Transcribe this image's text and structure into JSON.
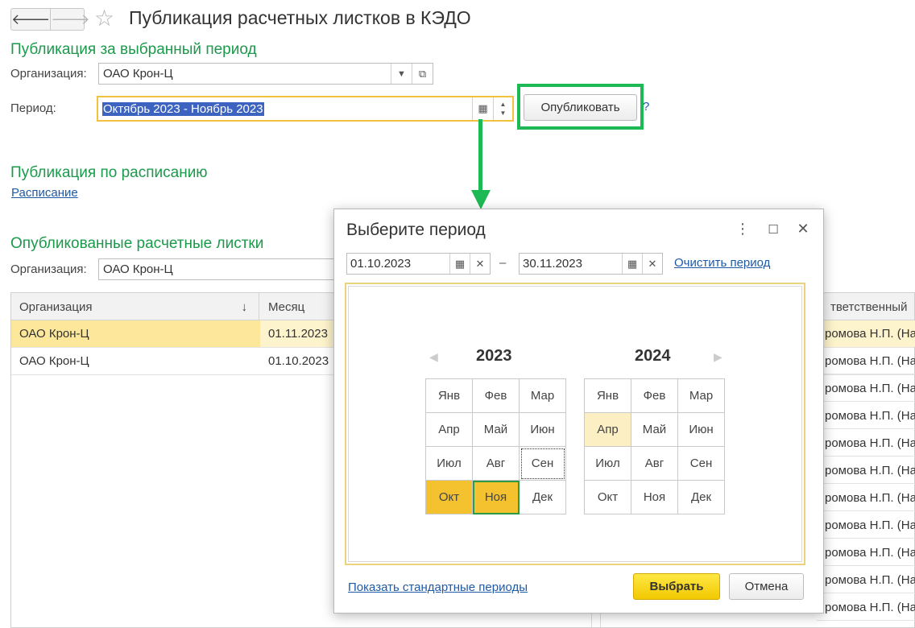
{
  "window": {
    "title": "Публикация расчетных листков в КЭДО"
  },
  "nav": {
    "back": "🡐",
    "forward": "🡒",
    "favorite": "☆"
  },
  "publish_section": {
    "title": "Публикация за выбранный период",
    "org_label": "Организация:",
    "org_value": "ОАО Крон-Ц",
    "period_label": "Период:",
    "period_value": "Октябрь 2023 - Ноябрь 2023",
    "publish_button": "Опубликовать",
    "help": "?"
  },
  "schedule_section": {
    "title": "Публикация по расписанию",
    "link": "Расписание"
  },
  "published_section": {
    "title": "Опубликованные расчетные листки",
    "org_label": "Организация:",
    "org_value": "ОАО Крон-Ц"
  },
  "table": {
    "columns": {
      "org": "Организация",
      "month": "Месяц",
      "responsible": "тветственный"
    },
    "sort_icon": "↓",
    "rows": [
      {
        "org": "ОАО Крон-Ц",
        "month": "01.11.2023"
      },
      {
        "org": "ОАО Крон-Ц",
        "month": "01.10.2023"
      }
    ],
    "responsible_values": [
      "ромова Н.П. (На",
      "ромова Н.П. (На",
      "ромова Н.П. (На",
      "ромова Н.П. (На",
      "ромова Н.П. (На",
      "ромова Н.П. (На",
      "ромова Н.П. (На",
      "ромова Н.П. (На",
      "ромова Н.П. (На",
      "ромова Н.П. (На",
      "ромова Н.П. (На",
      "ромова Н.П. (На"
    ]
  },
  "dialog": {
    "title": "Выберите период",
    "more_icon": "⋮",
    "maximize_icon": "☐",
    "close_icon": "✕",
    "date_from": "01.10.2023",
    "date_to": "30.11.2023",
    "dash": "–",
    "clear_link": "Очистить период",
    "prev_arrow": "◀",
    "next_arrow": "▶",
    "year_left": "2023",
    "year_right": "2024",
    "months": [
      "Янв",
      "Фев",
      "Мар",
      "Апр",
      "Май",
      "Июн",
      "Июл",
      "Авг",
      "Сен",
      "Окт",
      "Ноя",
      "Дек"
    ],
    "standard_periods_link": "Показать стандартные периоды",
    "ok_button": "Выбрать",
    "cancel_button": "Отмена"
  },
  "colors": {
    "section_title": "#1a9a4a",
    "link": "#1f5aa6",
    "selection": "#3c63c0",
    "highlight_box": "#1db954",
    "selected_month": "#f5c22f",
    "hover_month": "#fdefc4",
    "row_selected": "#fde79a",
    "primary_button": "#f2c900"
  }
}
